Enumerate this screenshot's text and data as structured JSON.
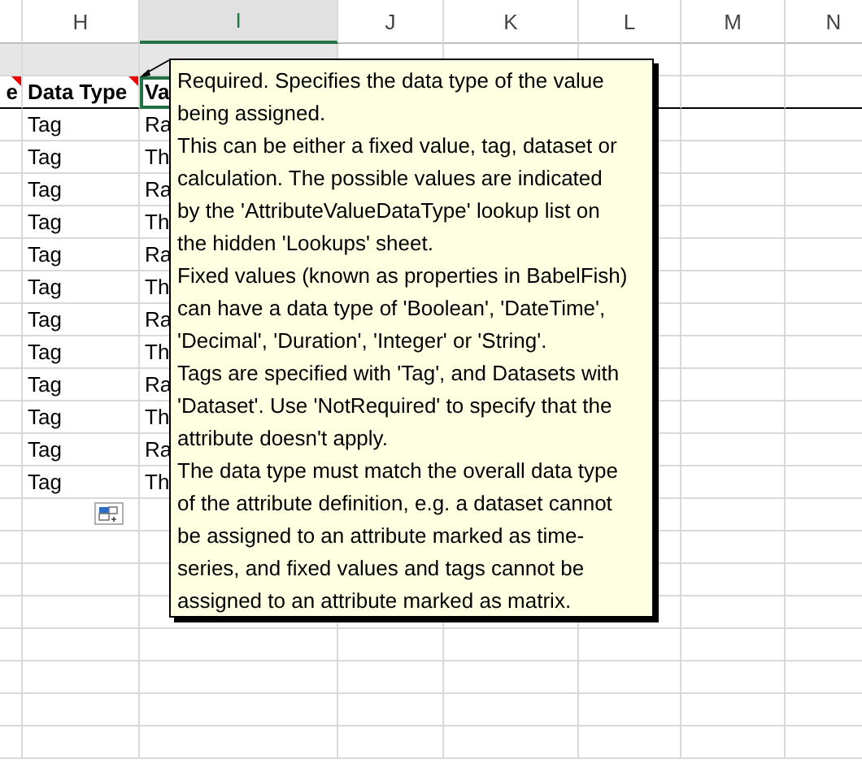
{
  "columns": [
    {
      "label": "H",
      "selected": false
    },
    {
      "label": "I",
      "selected": true
    },
    {
      "label": "J",
      "selected": false
    },
    {
      "label": "K",
      "selected": false
    },
    {
      "label": "L",
      "selected": false
    },
    {
      "label": "M",
      "selected": false
    },
    {
      "label": "N",
      "selected": false
    }
  ],
  "header_row": [
    {
      "text": "e",
      "has_comment": true,
      "selected": false
    },
    {
      "text": "Data Type",
      "has_comment": true,
      "selected": false
    },
    {
      "text": "Va",
      "has_comment": false,
      "selected": true
    }
  ],
  "rows": [
    {
      "data_type": "Tag",
      "value": "Ra"
    },
    {
      "data_type": "Tag",
      "value": "Th"
    },
    {
      "data_type": "Tag",
      "value": "Ra"
    },
    {
      "data_type": "Tag",
      "value": "Th"
    },
    {
      "data_type": "Tag",
      "value": "Ra"
    },
    {
      "data_type": "Tag",
      "value": "Th"
    },
    {
      "data_type": "Tag",
      "value": "Ra"
    },
    {
      "data_type": "Tag",
      "value": "Th"
    },
    {
      "data_type": "Tag",
      "value": "Ra"
    },
    {
      "data_type": "Tag",
      "value": "Th"
    },
    {
      "data_type": "Tag",
      "value": "Ra"
    },
    {
      "data_type": "Tag",
      "value": "Th"
    }
  ],
  "comment": {
    "paragraphs": [
      "Required. Specifies the data type of the value being assigned.",
      "This can be either a fixed value, tag, dataset or calculation. The possible values are indicated by the 'AttributeValueDataType' lookup list on the hidden 'Lookups' sheet.",
      "Fixed values (known as properties in BabelFish) can have a data type of 'Boolean', 'DateTime', 'Decimal', 'Duration', 'Integer' or 'String'.",
      "Tags are specified with 'Tag', and Datasets with 'Dataset'. Use 'NotRequired' to specify that the attribute doesn't apply.",
      "The data type must match the overall data type of the attribute definition, e.g. a dataset cannot be assigned to an attribute marked as time-series, and fixed values and tags cannot be assigned to an attribute marked as matrix."
    ]
  }
}
